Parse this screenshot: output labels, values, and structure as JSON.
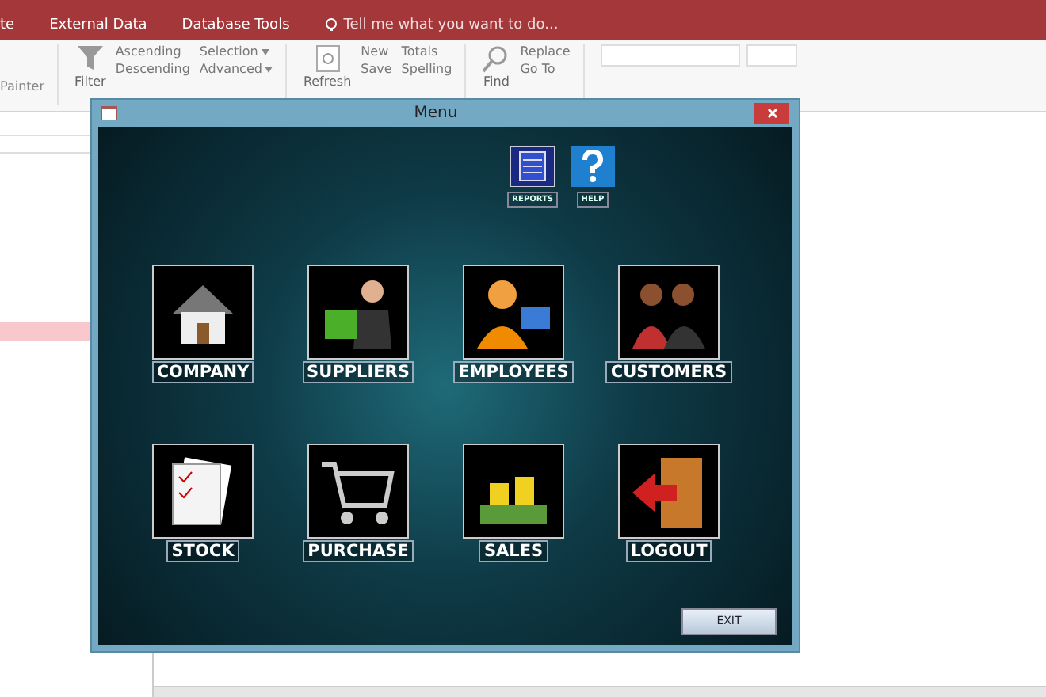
{
  "app_tabs": [
    "te",
    "External Data",
    "Database Tools"
  ],
  "tell_me": "Tell me what you want to do...",
  "ribbon": {
    "clipboard": [
      "Painter"
    ],
    "sort_filter": {
      "filter": "Filter",
      "commands": [
        "Ascending",
        "Descending"
      ],
      "options": [
        "Selection",
        "Advanced"
      ]
    },
    "records": {
      "refresh": "Refresh",
      "commands": [
        "New",
        "Save"
      ],
      "tools": [
        "Totals",
        "Spelling"
      ]
    },
    "find": {
      "find": "Find",
      "commands": [
        "Replace",
        "Go To"
      ]
    }
  },
  "menu_window": {
    "title": "Menu",
    "top_buttons": [
      {
        "label": "REPORTS",
        "kind": "reports"
      },
      {
        "label": "HELP",
        "kind": "help"
      }
    ],
    "tiles": [
      {
        "label": "COMPANY",
        "kind": "house"
      },
      {
        "label": "SUPPLIERS",
        "kind": "supplier"
      },
      {
        "label": "EMPLOYEES",
        "kind": "employee"
      },
      {
        "label": "CUSTOMERS",
        "kind": "customers"
      },
      {
        "label": "STOCK",
        "kind": "stock"
      },
      {
        "label": "PURCHASE",
        "kind": "cart"
      },
      {
        "label": "SALES",
        "kind": "money"
      },
      {
        "label": "LOGOUT",
        "kind": "door"
      }
    ],
    "exit": "EXIT"
  }
}
